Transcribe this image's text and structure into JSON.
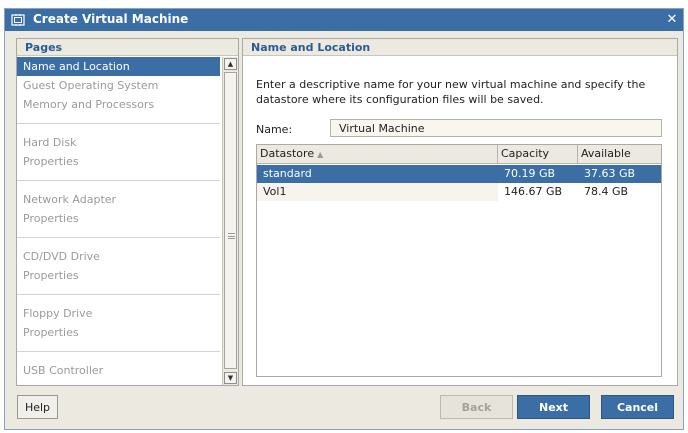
{
  "window": {
    "title": "Create Virtual Machine",
    "close_icon": "close-icon",
    "app_icon": "virtual-machine-icon"
  },
  "pages": {
    "header": "Pages",
    "groups": [
      [
        "Name and Location",
        "Guest Operating System",
        "Memory and Processors"
      ],
      [
        "Hard Disk",
        "Properties"
      ],
      [
        "Network Adapter",
        "Properties"
      ],
      [
        "CD/DVD Drive",
        "Properties"
      ],
      [
        "Floppy Drive",
        "Properties"
      ],
      [
        "USB Controller"
      ]
    ],
    "selected": "Name and Location"
  },
  "content": {
    "header": "Name and Location",
    "description": "Enter a descriptive name for your new virtual machine and specify the datastore where its configuration files will be saved.",
    "name_label": "Name:",
    "name_value": "Virtual Machine"
  },
  "datastore_table": {
    "columns": [
      "Datastore",
      "Capacity",
      "Available"
    ],
    "rows": [
      {
        "datastore": "standard",
        "capacity": "70.19 GB",
        "available": "37.63 GB"
      },
      {
        "datastore": "Vol1",
        "capacity": "146.67 GB",
        "available": "78.4 GB"
      }
    ],
    "selected_index": 0
  },
  "buttons": {
    "help": "Help",
    "back": "Back",
    "next": "Next",
    "cancel": "Cancel"
  },
  "colors": {
    "accent": "#3a6ea5",
    "panel_bg": "#ece9e0",
    "header_text": "#2b5b93"
  }
}
